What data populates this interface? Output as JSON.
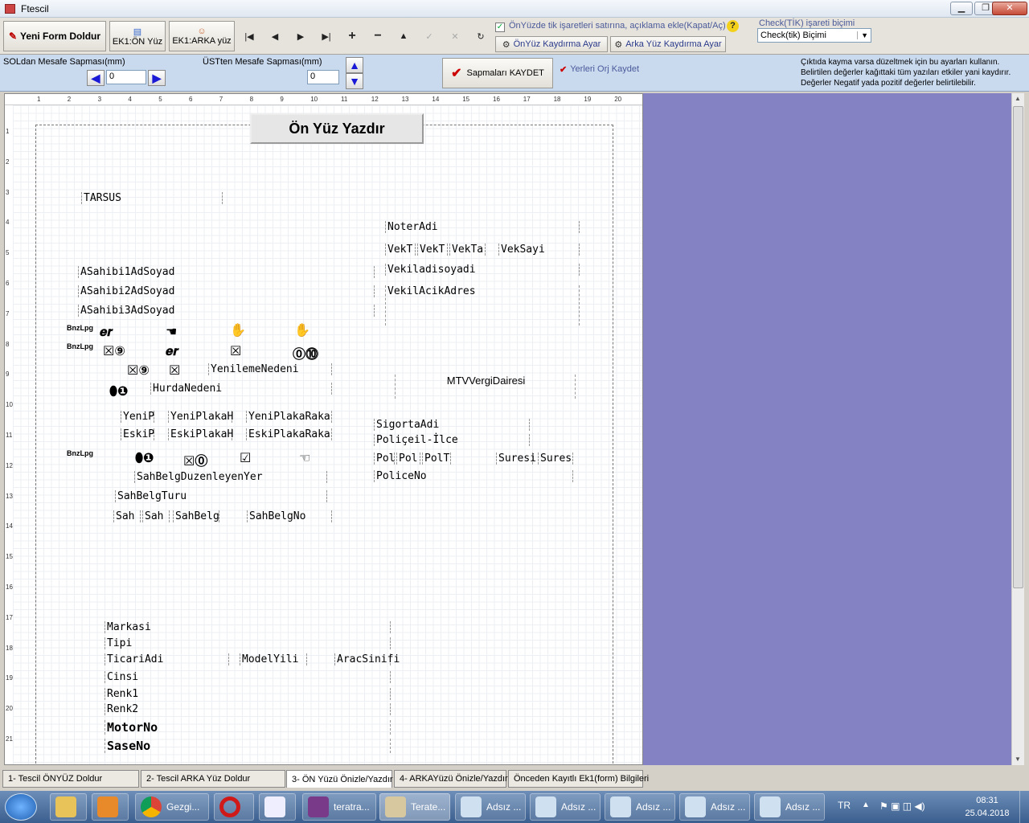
{
  "window": {
    "title": "Ftescil"
  },
  "toolbar": {
    "new_form": "Yeni Form Doldur",
    "ek1_front": "EK1:ÖN Yüz",
    "ek1_back": "EK1:ARKA yüz",
    "nav": [
      "|◀",
      "◀",
      "▶",
      "▶|",
      "+",
      "−",
      "▲",
      "✓",
      "✕",
      "↻"
    ],
    "tick_option": "ÖnYüzde tik işaretleri satırına, açıklama ekle(Kapat/Aç)",
    "front_shift": "ÖnYüz Kaydırma Ayar",
    "back_shift": "Arka Yüz Kaydırma Ayar",
    "tick_format_label": "Check(TİK) işareti biçimi",
    "tick_format_value": "Check(tik) Biçimi"
  },
  "settings": {
    "left_label": "SOLdan Mesafe Sapması(mm)",
    "left_value": "0",
    "top_label": "ÜSTten Mesafe Sapması(mm)",
    "top_value": "0",
    "save_label": "Sapmaları KAYDET",
    "reset_label": "Yerleri Orj Kaydet",
    "help": [
      "Çıktıda kayma varsa düzeltmek için bu ayarları kullanın.",
      "Belirtilen değerler kağıttaki tüm yazıları etkiler yani kaydırır.",
      "Değerler Negatif yada pozitif değerler belirtilebilir."
    ]
  },
  "ruler": {
    "top": [
      "1",
      "2",
      "3",
      "4",
      "5",
      "6",
      "7",
      "8",
      "9",
      "10",
      "11",
      "12",
      "13",
      "14",
      "15",
      "16",
      "17",
      "18",
      "19",
      "20"
    ],
    "left": [
      "1",
      "2",
      "3",
      "4",
      "5",
      "6",
      "7",
      "8",
      "9",
      "10",
      "11",
      "12",
      "13",
      "14",
      "15",
      "16",
      "17",
      "18",
      "19",
      "20",
      "21"
    ]
  },
  "preview": {
    "print_button": "Ön Yüz Yazdır",
    "fields": {
      "city": "TARSUS",
      "noter": "NoterAdi",
      "vek1": "VekT",
      "vek2": "VekT",
      "vek3": "VekTa",
      "veksayi": "VekSayi",
      "vekil": "Vekiladisoyadi",
      "vekiladres": "VekilAcikAdres",
      "as1": "ASahibi1AdSoyad",
      "as2": "ASahibi2AdSoyad",
      "as3": "ASahibi3AdSoyad",
      "bnz1": "BnzLpg",
      "bnz2": "BnzLpg",
      "bnz3": "BnzLpg",
      "yenileme": "YenilemeNedeni",
      "hurda": "HurdaNedeni",
      "mtv": "MTVVergiDairesi",
      "yenip": "YeniP",
      "yeniplakah": "YeniPlakaH",
      "yeniplakaraka": "YeniPlakaRaka",
      "eskip": "EskiP",
      "eskiplakah": "EskiPlakaH",
      "eskiplakaraka": "EskiPlakaRaka",
      "sigorta": "SigortaAdi",
      "police_ilce": "Poliçeil-İlce",
      "pol1": "Pol",
      "pol2": "Pol",
      "pol3": "PolT",
      "suresi1": "Suresi",
      "suresi2": "Sures",
      "policeno": "PoliceNo",
      "sahbelgyer": "SahBelgDuzenleyenYer",
      "sahbelgturu": "SahBelgTuru",
      "sah1": "Sah",
      "sah2": "Sah",
      "sahbelg": "SahBelg",
      "sahbelgno": "SahBelgNo",
      "markasi": "Markasi",
      "tipi": "Tipi",
      "ticari": "TicariAdi",
      "modelyili": "ModelYili",
      "aracsinifi": "AracSinifi",
      "cinsi": "Cinsi",
      "renk1": "Renk1",
      "renk2": "Renk2",
      "motorno": "MotorNo",
      "saseno": "SaseNo"
    }
  },
  "tabs": [
    "1- Tescil ÖNYÜZ Doldur",
    "2- Tescil ARKA Yüz Doldur",
    "3- ÖN Yüzü Önizle/Yazdır",
    "4- ARKAYüzü Önizle/Yazdır",
    "Önceden Kayıtlı Ek1(form) Bilgileri"
  ],
  "taskbar": {
    "items": [
      "Gezgi...",
      "teratra...",
      "Terate...",
      "Adsız ...",
      "Adsız ...",
      "Adsız ...",
      "Adsız ...",
      "Adsız ..."
    ],
    "lang": "TR",
    "time": "08:31",
    "date": "25.04.2018"
  },
  "colors": {
    "accent": "#8482c2",
    "settings_bg": "#c9d9ee"
  }
}
